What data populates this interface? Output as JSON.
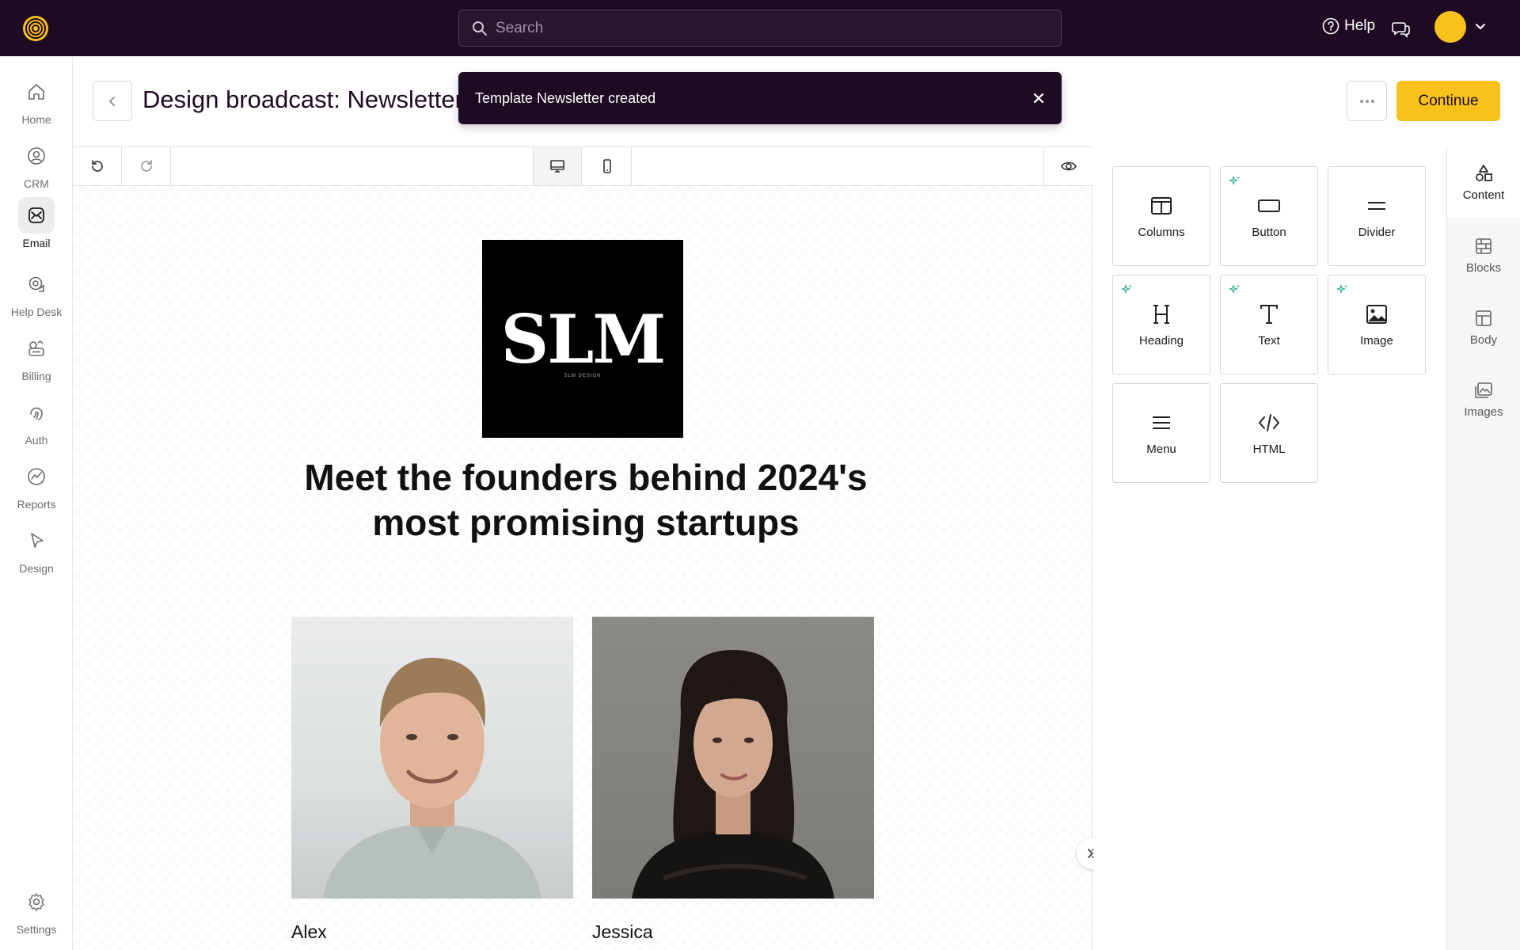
{
  "topbar": {
    "search_placeholder": "Search",
    "help_label": "Help",
    "avatar_color": "#f8c21a"
  },
  "nav": {
    "items": [
      {
        "label": "Home",
        "icon": "home-icon"
      },
      {
        "label": "CRM",
        "icon": "user-circle-icon"
      },
      {
        "label": "Email",
        "icon": "email-icon",
        "active": true
      },
      {
        "label": "Help Desk",
        "icon": "chat-bubbles-icon"
      },
      {
        "label": "Billing",
        "icon": "billing-icon"
      },
      {
        "label": "Auth",
        "icon": "fingerprint-icon"
      },
      {
        "label": "Reports",
        "icon": "chart-icon"
      },
      {
        "label": "Design",
        "icon": "cursor-icon"
      }
    ],
    "settings_label": "Settings"
  },
  "header": {
    "title": "Design broadcast: Newsletter",
    "continue_label": "Continue"
  },
  "toast": {
    "message": "Template Newsletter created"
  },
  "email": {
    "logo_text": "SLM",
    "logo_sub": "SLM DESIGN",
    "heading": "Meet the founders behind 2024's most promising startups",
    "people": [
      {
        "name": "Alex"
      },
      {
        "name": "Jessica"
      }
    ]
  },
  "tools": {
    "items": [
      {
        "label": "Columns",
        "icon": "columns-icon",
        "ai": false
      },
      {
        "label": "Button",
        "icon": "button-icon",
        "ai": true
      },
      {
        "label": "Divider",
        "icon": "divider-icon",
        "ai": false
      },
      {
        "label": "Heading",
        "icon": "heading-icon",
        "ai": true
      },
      {
        "label": "Text",
        "icon": "text-icon",
        "ai": true
      },
      {
        "label": "Image",
        "icon": "image-icon",
        "ai": true
      },
      {
        "label": "Menu",
        "icon": "menu-icon",
        "ai": false
      },
      {
        "label": "HTML",
        "icon": "code-icon",
        "ai": false
      }
    ]
  },
  "side_tabs": {
    "items": [
      {
        "label": "Content",
        "icon": "shapes-icon",
        "active": true
      },
      {
        "label": "Blocks",
        "icon": "blocks-icon"
      },
      {
        "label": "Body",
        "icon": "layout-icon"
      },
      {
        "label": "Images",
        "icon": "images-icon"
      }
    ]
  },
  "colors": {
    "topbar_bg": "#1f0a24",
    "accent": "#f8c21a",
    "ai_sparkle": "#3bb39a"
  }
}
